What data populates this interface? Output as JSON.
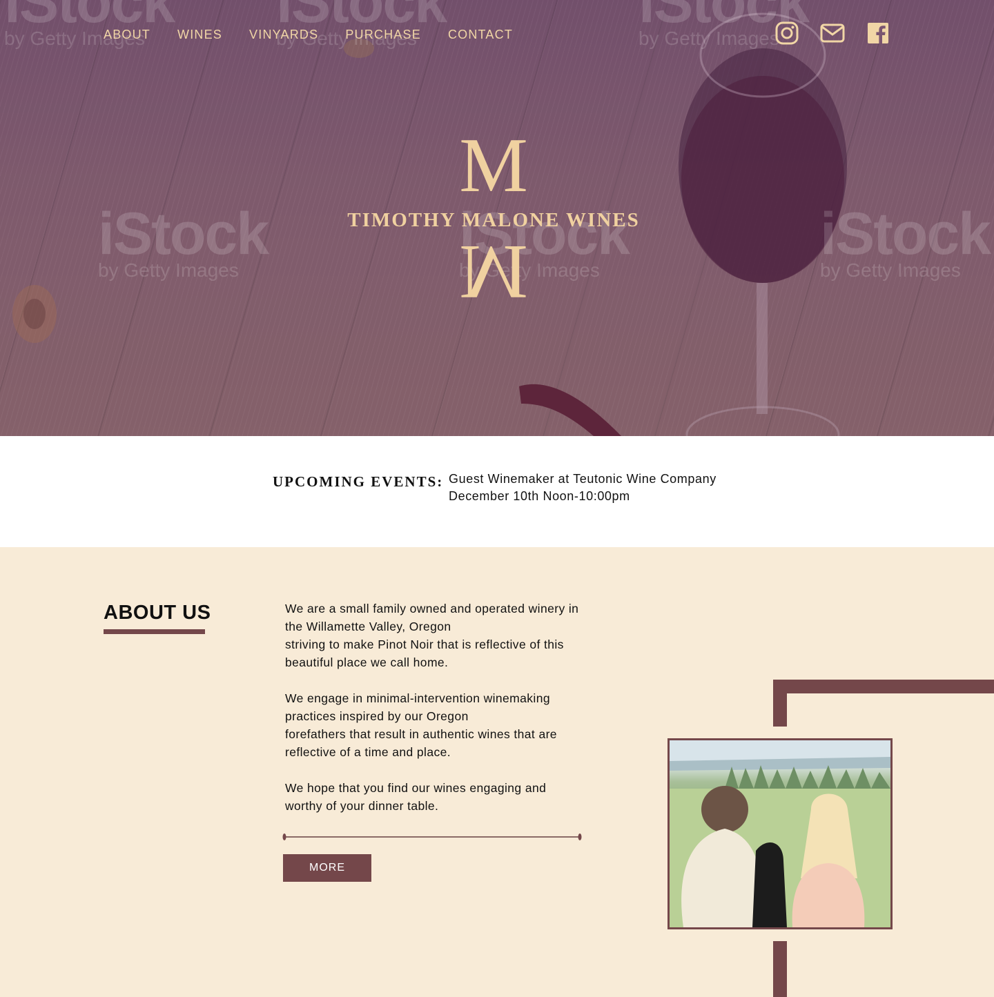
{
  "nav": {
    "items": [
      {
        "label": "ABOUT"
      },
      {
        "label": "WINES"
      },
      {
        "label": "VINYARDS"
      },
      {
        "label": "PURCHASE"
      },
      {
        "label": "CONTACT"
      }
    ]
  },
  "social": {
    "icons": [
      "instagram-icon",
      "mail-icon",
      "facebook-icon"
    ]
  },
  "hero": {
    "watermark_brand": "iStock",
    "watermark_sub": "by Getty Images",
    "logo_letter": "M",
    "logo_name": "TIMOTHY MALONE WINES"
  },
  "events": {
    "label": "UPCOMING EVENTS:",
    "line1": "Guest Winemaker at Teutonic Wine Company",
    "line2": "December 10th Noon-10:00pm"
  },
  "about": {
    "title": "ABOUT US",
    "paragraphs": [
      {
        "lines": [
          "We are a small family owned and operated winery in",
          "the Willamette Valley, Oregon",
          "striving to make Pinot Noir that is reflective of this",
          "beautiful place we call home."
        ]
      },
      {
        "lines": [
          "We engage in minimal-intervention winemaking",
          "practices inspired by our Oregon",
          "forefathers that result in authentic wines that are",
          "reflective of a time and place."
        ]
      },
      {
        "lines": [
          "We hope that you find our wines engaging and",
          "worthy of your dinner table."
        ]
      }
    ],
    "more_label": "MORE"
  },
  "colors": {
    "accent": "#74474a",
    "cream": "#f8ebd7",
    "gold": "#f0d1a0"
  }
}
